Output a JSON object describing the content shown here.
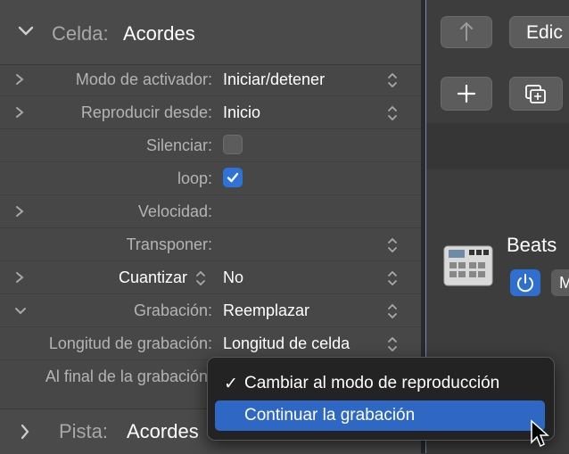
{
  "inspector": {
    "header": {
      "label": "Celda:",
      "value": "Acordes"
    },
    "rows": [
      {
        "label": "Modo de activador:",
        "value": "Iniciar/detener"
      },
      {
        "label": "Reproducir desde:",
        "value": "Inicio"
      },
      {
        "label": "Silenciar:",
        "checked": false
      },
      {
        "label": "loop:",
        "checked": true
      },
      {
        "label": "Velocidad:"
      },
      {
        "label": "Transponer:"
      },
      {
        "label": "Cuantizar",
        "value": "No"
      },
      {
        "label": "Grabación:",
        "value": "Reemplazar"
      },
      {
        "label": "Longitud de grabación:",
        "value": "Longitud de celda"
      },
      {
        "label": "Al final de la grabación:"
      }
    ],
    "footer": {
      "label": "Pista:",
      "value": "Acordes"
    }
  },
  "right_panel": {
    "edit_label": "Edic",
    "track_name": "Beats",
    "m_label": "M"
  },
  "popup_menu": {
    "items": [
      {
        "label": "Cambiar al modo de reproducción",
        "checked": true
      },
      {
        "label": "Continuar la grabación",
        "checked": false,
        "highlighted": true
      }
    ],
    "check_glyph": "✓"
  },
  "colors": {
    "accent": "#2f6fd0",
    "menu_highlight": "#2f68c4"
  }
}
